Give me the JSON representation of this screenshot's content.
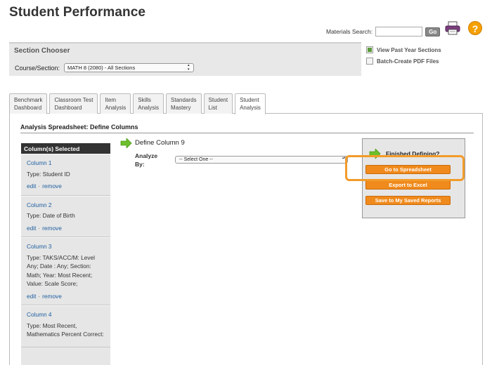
{
  "page": {
    "title": "Student Performance"
  },
  "header": {
    "materials_search_label": "Materials Search:",
    "materials_search_value": "",
    "go_label": "Go",
    "help_glyph": "?"
  },
  "section_chooser": {
    "title": "Section Chooser",
    "course_label": "Course/Section:",
    "course_value": "MATH 8 (2080) - All Sections"
  },
  "side_links": [
    {
      "label": "View Past Year Sections",
      "icon": "spreadsheet-icon"
    },
    {
      "label": "Batch-Create PDF Files",
      "icon": "document-icon"
    }
  ],
  "tabs": [
    {
      "line1": "Benchmark",
      "line2": "Dashboard",
      "active": false
    },
    {
      "line1": "Classroom Test",
      "line2": "Dashboard",
      "active": false
    },
    {
      "line1": "Item",
      "line2": "Analysis",
      "active": false
    },
    {
      "line1": "Skills",
      "line2": "Analysis",
      "active": false
    },
    {
      "line1": "Standards",
      "line2": "Mastery",
      "active": false
    },
    {
      "line1": "Student",
      "line2": "List",
      "active": false
    },
    {
      "line1": "Student",
      "line2": "Analysis",
      "active": true
    }
  ],
  "main": {
    "title": "Analysis Spreadsheet: Define Columns",
    "columns_header": "Column(s) Selected",
    "edit_label": "edit",
    "remove_label": "remove",
    "columns": [
      {
        "name": "Column 1",
        "type": "Type: Student ID"
      },
      {
        "name": "Column 2",
        "type": "Type: Date of Birth"
      },
      {
        "name": "Column 3",
        "type": "Type: TAKS/ACC/M: Level Any; Date : Any; Section: Math; Year: Most Recent; Value: Scale Score;"
      },
      {
        "name": "Column 4",
        "type": "Type: Most Recent, Mathematics Percent Correct:"
      }
    ],
    "define_title": "Define Column 9",
    "analyze_label_1": "Analyze",
    "analyze_label_2": "By:",
    "analyze_value": "-- Select One --"
  },
  "finish_panel": {
    "title": "Finished Defining?",
    "go_to_spreadsheet": "Go to Spreadsheet",
    "export_to_excel": "Export to Excel",
    "save_reports": "Save to My Saved Reports"
  },
  "colors": {
    "accent_orange": "#f08a1c",
    "highlight_ring": "#f29b2a",
    "link_blue": "#1f5fa0",
    "arrow_green": "#6cbf2c"
  }
}
